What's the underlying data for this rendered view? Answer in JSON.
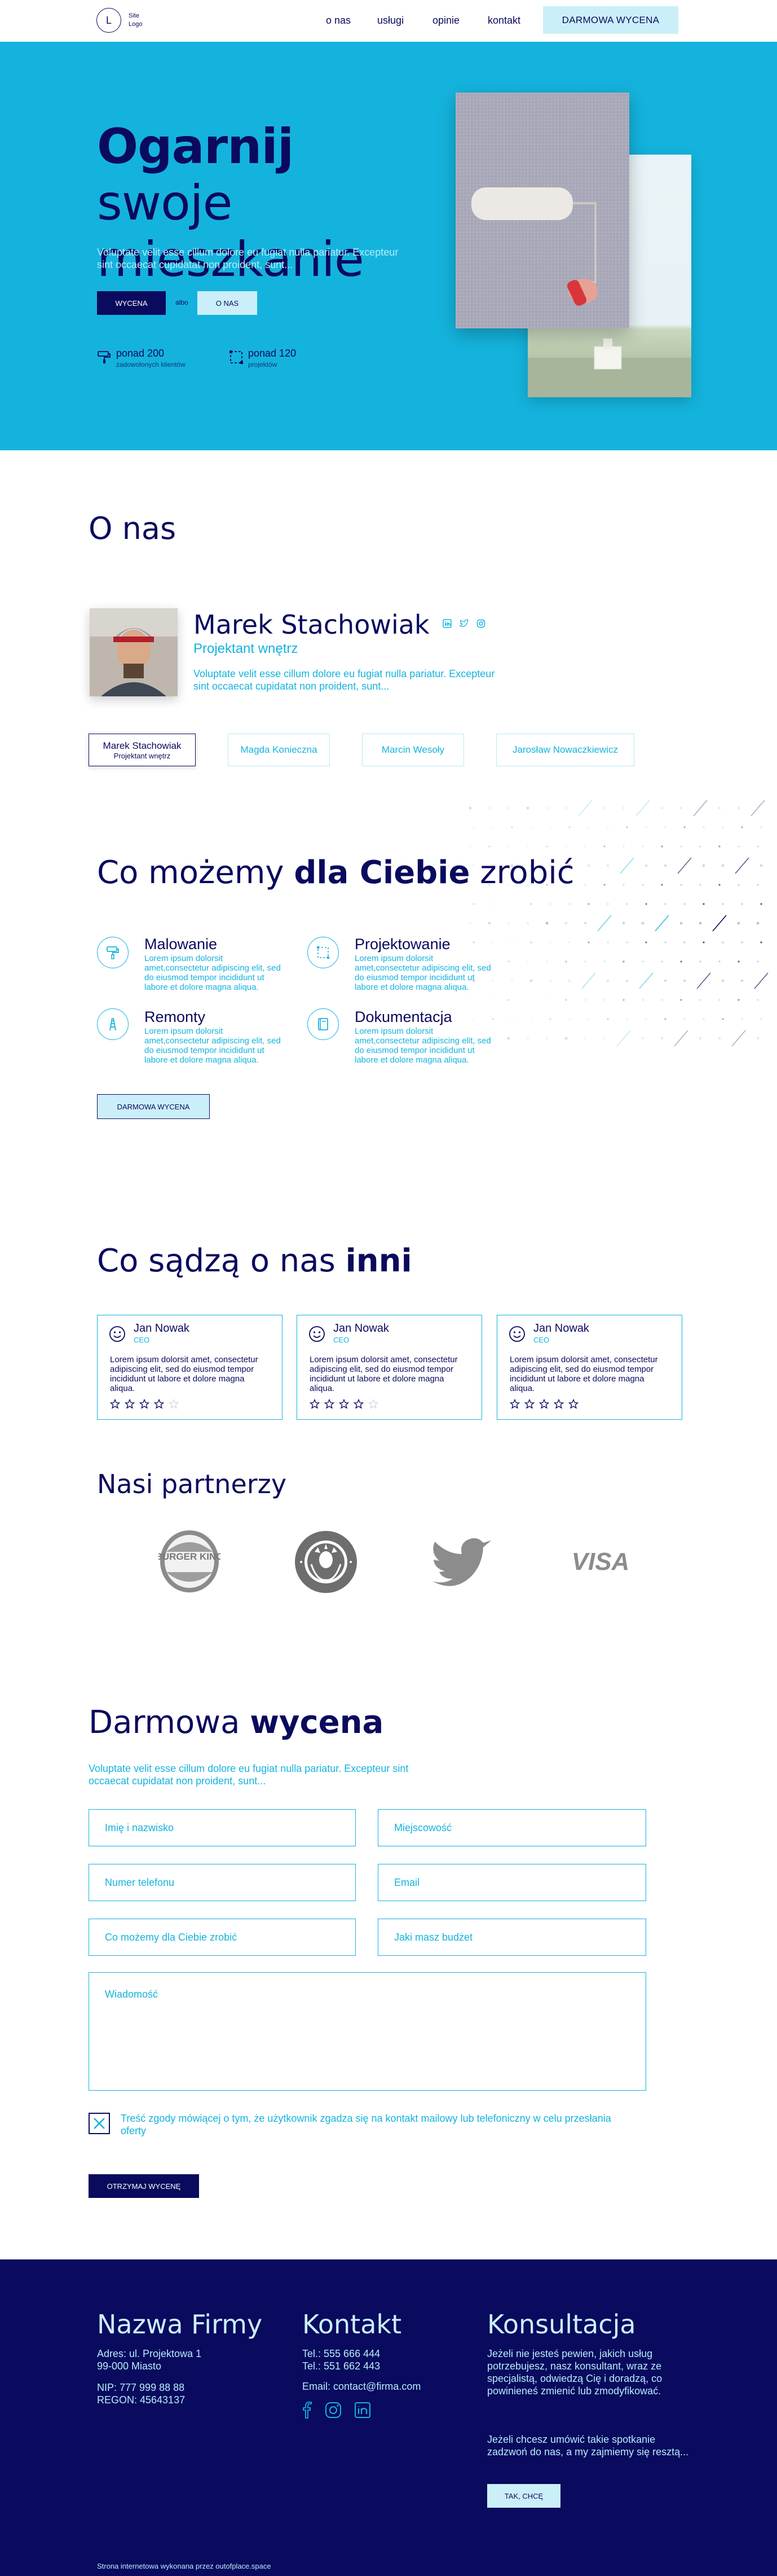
{
  "nav": {
    "logo_letter": "L",
    "logo_text": "Site Logo",
    "links": [
      "o nas",
      "usługi",
      "opinie",
      "kontakt"
    ],
    "cta": "DARMOWA WYCENA"
  },
  "hero": {
    "title_bold": "Ogarnij",
    "title_rest": " swoje mieszkanie",
    "subtitle": "Voluptate velit esse cillum dolore eu fugiat nulla pariatur. Excepteur sint occaecat cupidatat non proident, sunt...",
    "btn_primary": "WYCENA",
    "or": "albo",
    "btn_secondary": "O NAS",
    "stats": [
      {
        "icon": "paint-roller-icon",
        "num": "ponad 200",
        "label": "zadowolonych klientów"
      },
      {
        "icon": "selection-icon",
        "num": "ponad 120",
        "label": "projektów"
      }
    ]
  },
  "about": {
    "title": "O nas",
    "name": "Marek Stachowiak",
    "role": "Projektant wnętrz",
    "desc": "Voluptate velit esse cillum dolore eu fugiat nulla pariatur. Excepteur sint occaecat cupidatat non proident, sunt...",
    "tabs": [
      {
        "name": "Marek Stachowiak",
        "role": "Projektant wnętrz",
        "active": true
      },
      {
        "name": "Magda Konieczna",
        "role": "",
        "active": false
      },
      {
        "name": "Marcin Wesoły",
        "role": "",
        "active": false
      },
      {
        "name": "Jarosław Nowaczkiewicz",
        "role": "",
        "active": false
      }
    ]
  },
  "services": {
    "title_pre": "Co możemy ",
    "title_bold": "dla Ciebie",
    "title_post": " zrobić",
    "items": [
      {
        "icon": "paint-roller-icon",
        "title": "Malowanie",
        "desc": "Lorem ipsum dolorsit amet,consectetur adipiscing elit, sed do eiusmod tempor incididunt ut labore et dolore magna aliqua."
      },
      {
        "icon": "selection-icon",
        "title": "Projektowanie",
        "desc": "Lorem ipsum dolorsit amet,consectetur adipiscing elit, sed do eiusmod tempor incididunt ut labore et dolore magna aliqua."
      },
      {
        "icon": "ladder-icon",
        "title": "Remonty",
        "desc": "Lorem ipsum dolorsit amet,consectetur adipiscing elit, sed do eiusmod tempor incididunt ut labore et dolore magna aliqua."
      },
      {
        "icon": "book-icon",
        "title": "Dokumentacja",
        "desc": "Lorem ipsum dolorsit amet,consectetur adipiscing elit, sed do eiusmod tempor incididunt ut labore et dolore magna aliqua."
      }
    ],
    "cta": "DARMOWA WYCENA"
  },
  "testimonials": {
    "title_pre": "Co sądzą o nas ",
    "title_bold": "inni",
    "cards": [
      {
        "name": "Jan Nowak",
        "role": "CEO",
        "text": "Lorem ipsum dolorsit amet, consectetur adipiscing elit, sed do eiusmod tempor incididunt ut labore et dolore magna aliqua.",
        "rating": 4
      },
      {
        "name": "Jan Nowak",
        "role": "CEO",
        "text": "Lorem ipsum dolorsit amet, consectetur adipiscing elit, sed do eiusmod tempor incididunt ut labore et dolore magna aliqua.",
        "rating": 4
      },
      {
        "name": "Jan Nowak",
        "role": "CEO",
        "text": "Lorem ipsum dolorsit amet, consectetur adipiscing elit, sed do eiusmod tempor incididunt ut labore et dolore magna aliqua.",
        "rating": 5
      }
    ]
  },
  "partners": {
    "title": "Nasi partnerzy",
    "logos": [
      {
        "icon": "burger-king-logo",
        "text": "BURGER KING"
      },
      {
        "icon": "starbucks-logo",
        "text": ""
      },
      {
        "icon": "twitter-logo",
        "text": ""
      },
      {
        "icon": "visa-logo",
        "text": "VISA"
      }
    ]
  },
  "quote_form": {
    "title_pre": "Darmowa ",
    "title_bold": "wycena",
    "subtitle": "Voluptate velit esse cillum dolore eu fugiat nulla pariatur. Excepteur sint occaecat cupidatat non proident, sunt...",
    "fields": {
      "name": "Imię i nazwisko",
      "city": "Miejscowość",
      "phone": "Numer telefonu",
      "email": "Email",
      "service": "Co możemy dla Ciebie zrobić",
      "budget": "Jaki masz budżet",
      "message": "Wiadomość"
    },
    "consent": "Treść zgody mówiącej o tym, że użytkownik zgadza się na kontakt mailowy lub telefoniczny w celu przesłania oferty",
    "consent_checked": true,
    "submit": "OTRZYMAJ WYCENĘ"
  },
  "footer": {
    "company_title": "Nazwa Firmy",
    "address_1": "Adres: ul. Projektowa 1",
    "address_2": "99-000 Miasto",
    "nip": "NIP: 777 999 88 88",
    "regon": "REGON: 45643137",
    "contact_title": "Kontakt",
    "tel_1": "Tel.: 555 666 444",
    "tel_2": "Tel.: 551 662 443",
    "email": "Email: contact@firma.com",
    "consult_title": "Konsultacja",
    "consult_text_1": "Jeżeli nie jesteś pewien, jakich usług potrzebujesz, nasz konsultant, wraz ze specjalistą, odwiedzą Cię i doradzą, co powinieneś zmienić lub zmodyfikować.",
    "consult_text_2": "Jeżeli chcesz umówić takie spotkanie zadzwoń do nas, a my zajmiemy się resztą...",
    "consult_btn": "TAK, CHCĘ",
    "credit": "Strona internetowa wykonana przez outofplace.space"
  },
  "colors": {
    "navy": "#0a0a5e",
    "cyan": "#14b3dd",
    "light": "#cbeff8"
  }
}
